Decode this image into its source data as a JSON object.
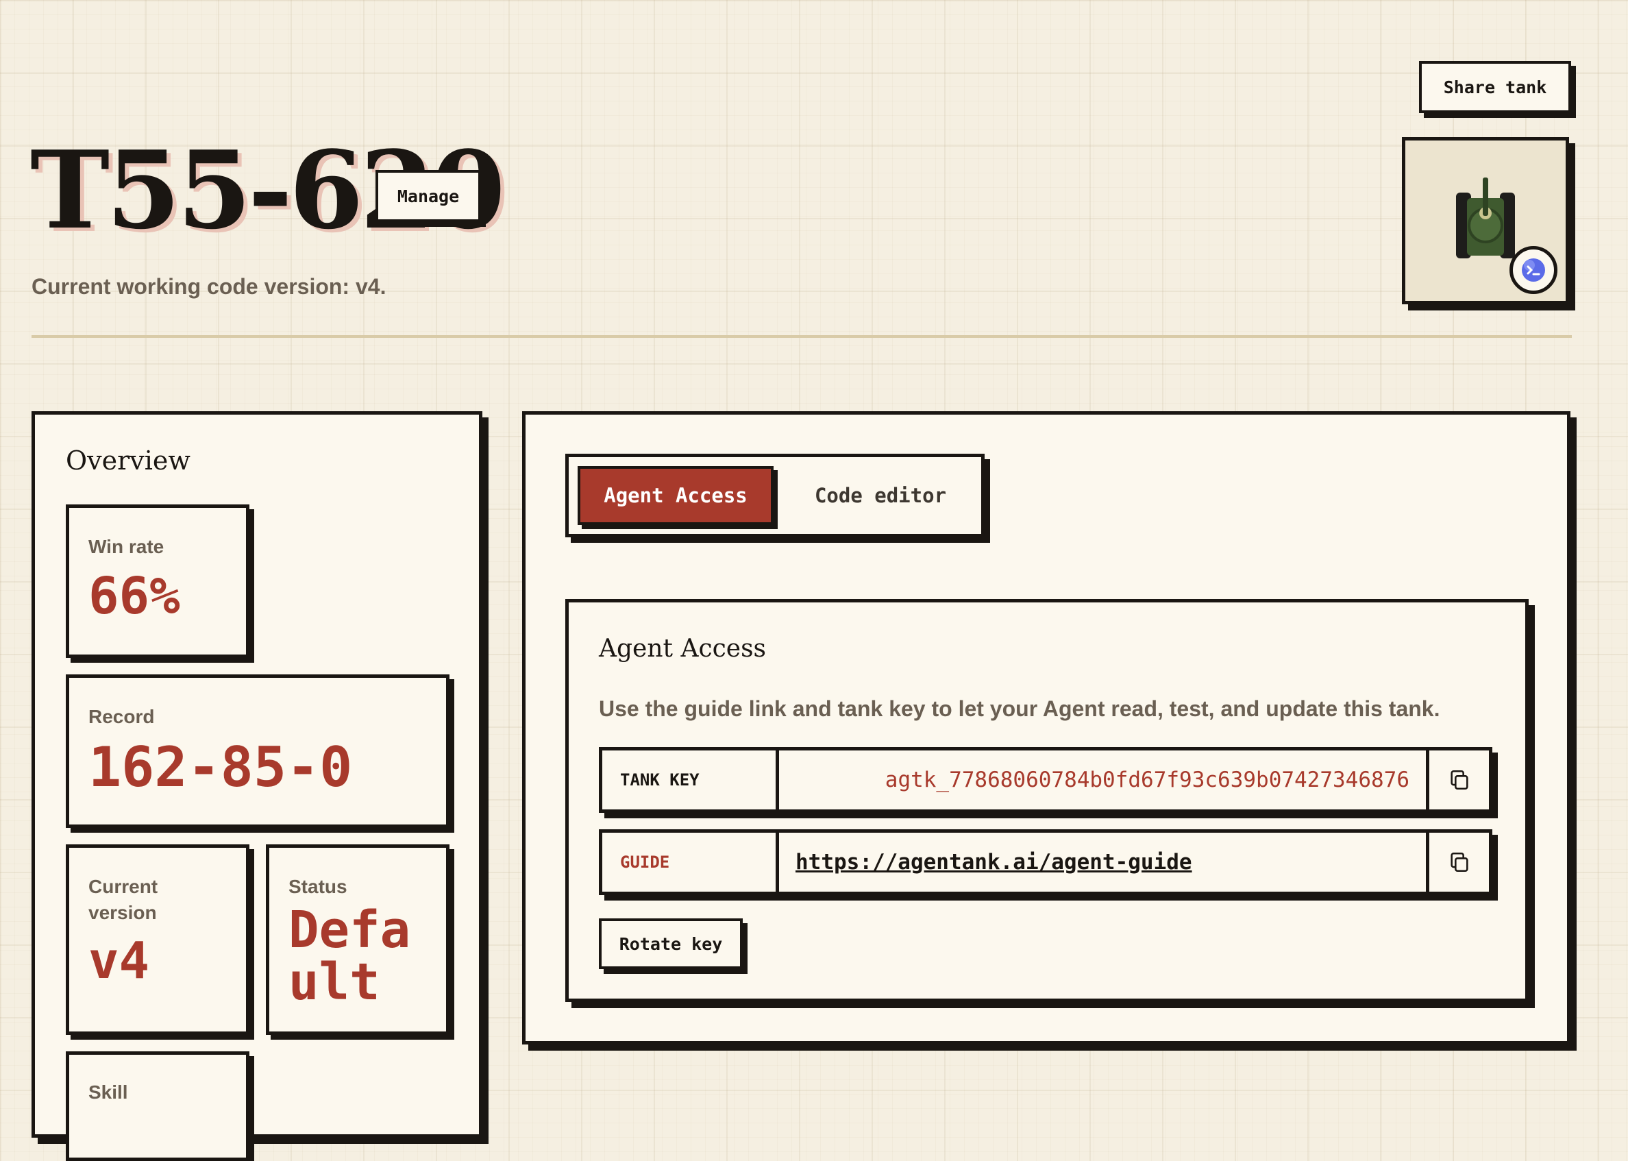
{
  "header": {
    "title": "T55-620",
    "manage_label": "Manage",
    "subtitle": "Current working code version: v4.",
    "share_label": "Share tank"
  },
  "overview": {
    "heading": "Overview",
    "win_rate": {
      "label": "Win rate",
      "value": "66%"
    },
    "record": {
      "label": "Record",
      "value": "162-85-0"
    },
    "current_version": {
      "label_line1": "Current",
      "label_line2": "version",
      "value": "v4"
    },
    "status": {
      "label": "Status",
      "value_line1": "Defa",
      "value_line2": "ult"
    },
    "skill": {
      "label": "Skill"
    }
  },
  "tabs": [
    {
      "label": "Agent Access",
      "active": true
    },
    {
      "label": "Code editor",
      "active": false
    }
  ],
  "agent_access": {
    "heading": "Agent Access",
    "description": "Use the guide link and tank key to let your Agent read, test, and update this tank.",
    "tank_key": {
      "label": "TANK KEY",
      "value": "agtk_77868060784b0fd67f93c639b07427346876"
    },
    "guide": {
      "label": "GUIDE",
      "value": "https://agentank.ai/agent-guide"
    },
    "rotate_label": "Rotate key"
  },
  "colors": {
    "accent": "#a83a2c",
    "ink": "#1a1612",
    "paper": "#fcf8ee",
    "background": "#f5efe1",
    "muted_text": "#6a5f52"
  },
  "icons": {
    "copy": "copy-icon",
    "avatar": "tank-icon",
    "badge": "agent-terminal-icon"
  }
}
